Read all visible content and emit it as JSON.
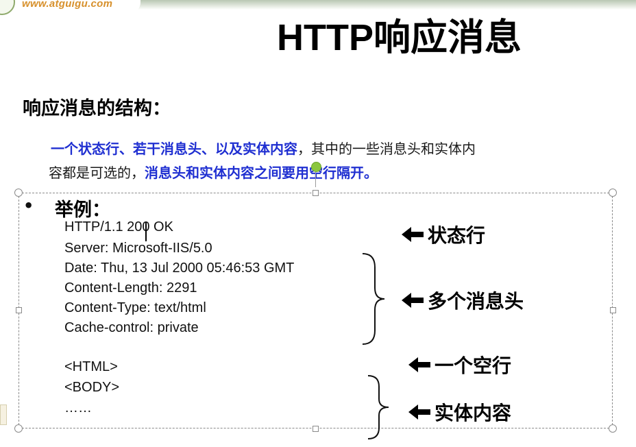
{
  "logo": {
    "url_text": "www.atguigu.com"
  },
  "slide": {
    "title": "HTTP响应消息",
    "section_heading": "响应消息的结构：",
    "description": {
      "highlight1": "一个状态行、若干消息头、以及实体内容",
      "text1": "，其中的一些消息头和实体内",
      "text2": "容都是可选的，",
      "highlight2": "消息头和实体内容之间要用空行隔开。"
    },
    "bullet": "•",
    "example_heading": "举例：",
    "example_lines": [
      "HTTP/1.1 200 OK",
      "Server: Microsoft-IIS/5.0",
      "Date: Thu, 13 Jul 2000 05:46:53  GMT",
      "Content-Length:  2291",
      "Content-Type:  text/html",
      "Cache-control:  private",
      "<HTML>",
      "<BODY>",
      "……"
    ],
    "annotations": {
      "status_line": "状态行",
      "headers": "多个消息头",
      "blank_line": "一个空行",
      "entity": "实体内容"
    }
  },
  "colors": {
    "highlight": "#1f2fd1",
    "rotate_handle": "#8cc63f",
    "logo": "#d7902b"
  }
}
